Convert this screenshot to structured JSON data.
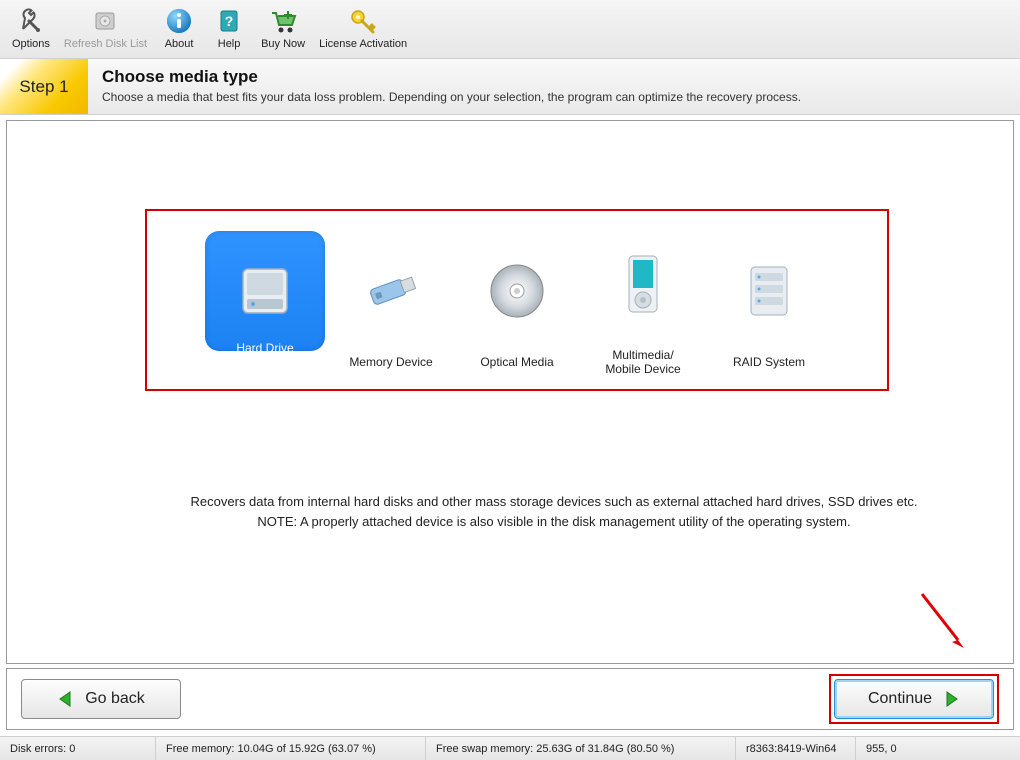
{
  "toolbar": {
    "options": "Options",
    "refresh": "Refresh Disk List",
    "about": "About",
    "help": "Help",
    "buy": "Buy Now",
    "license": "License Activation"
  },
  "step": {
    "badge": "Step 1",
    "title": "Choose media type",
    "sub": "Choose a media that best fits your data loss problem. Depending on your selection, the program can optimize the recovery process."
  },
  "media": {
    "hard_drive": "Hard Drive",
    "memory_device": "Memory Device",
    "optical_media": "Optical Media",
    "multimedia": "Multimedia/\nMobile Device",
    "raid": "RAID System"
  },
  "description": {
    "main": "Recovers data from internal hard disks and other mass storage devices such as external attached hard drives, SSD drives etc.",
    "note": "NOTE: A properly attached device is also visible in the disk management utility of the operating system."
  },
  "nav": {
    "back": "Go back",
    "continue": "Continue"
  },
  "status": {
    "errors": "Disk errors: 0",
    "free_mem": "Free memory: 10.04G of 15.92G (63.07 %)",
    "free_swap": "Free swap memory: 25.63G of 31.84G (80.50 %)",
    "build": "r8363:8419-Win64",
    "pos": "955, 0"
  }
}
